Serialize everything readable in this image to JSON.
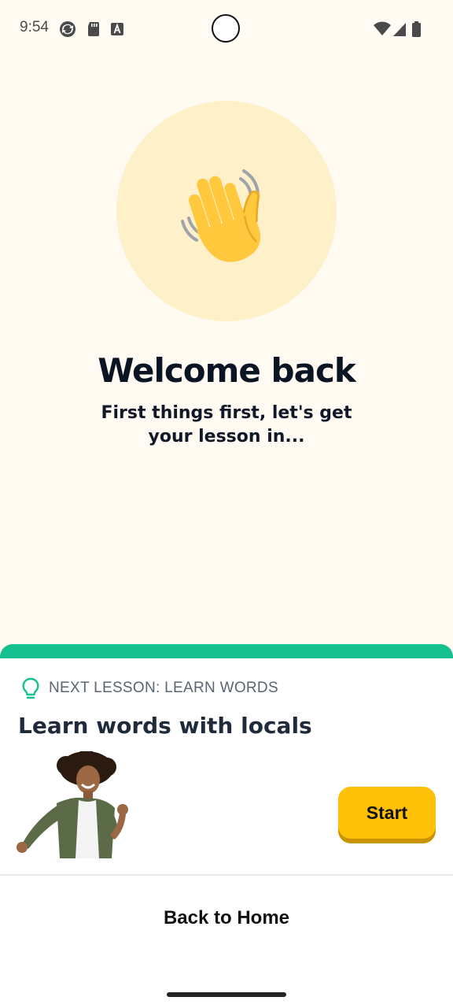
{
  "status_bar": {
    "time": "9:54",
    "left_icons": [
      "sync-icon",
      "sd-card-icon",
      "text-a-icon"
    ],
    "right_icons": [
      "wifi-icon",
      "cellular-signal-icon",
      "battery-icon"
    ]
  },
  "welcome": {
    "emoji_icon": "waving-hand-icon",
    "title": "Welcome back",
    "subtitle": "First things first, let's get your lesson in..."
  },
  "lesson_card": {
    "accent_color": "#16C08F",
    "label_icon": "lightbulb-icon",
    "label": "NEXT LESSON: LEARN WORDS",
    "title": "Learn words with locals",
    "start_button": "Start",
    "start_color": "#FFC107"
  },
  "footer": {
    "back_home": "Back to Home"
  }
}
